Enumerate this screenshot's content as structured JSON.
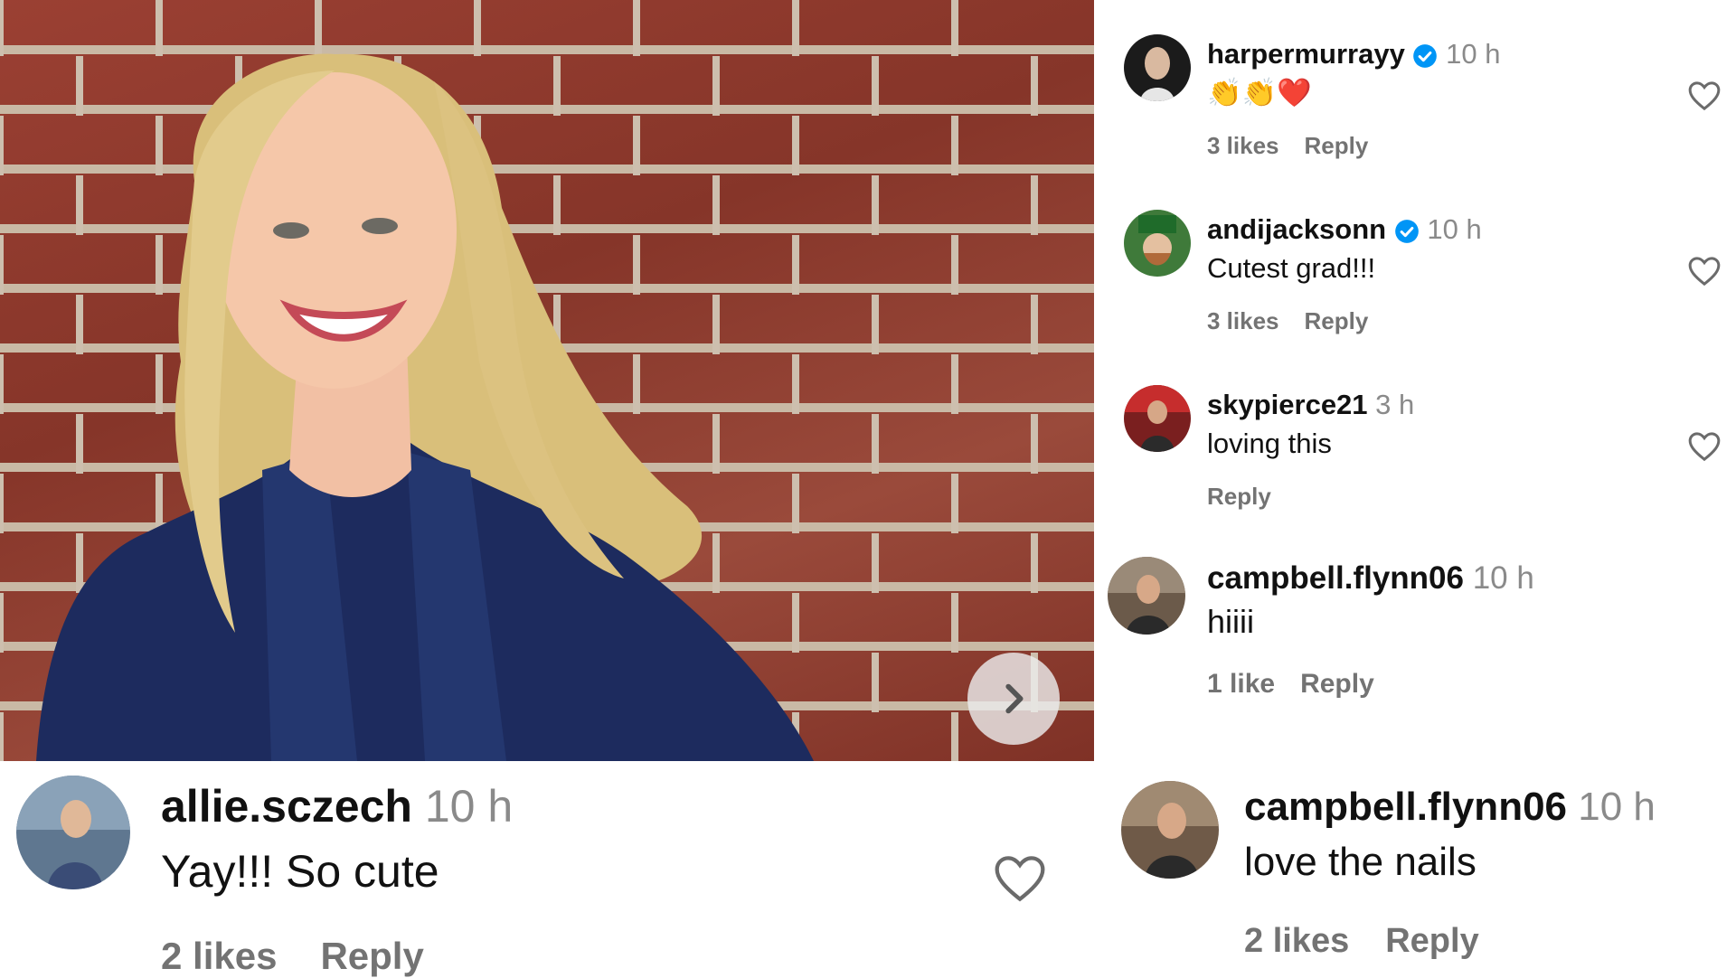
{
  "photo": {
    "next_icon": "chevron-right-icon"
  },
  "comments": [
    {
      "username": "harpermurrayy",
      "verified": true,
      "time": "10 h",
      "text": "👏👏❤️",
      "likes": "3 likes",
      "reply": "Reply"
    },
    {
      "username": "andijacksonn",
      "verified": true,
      "time": "10 h",
      "text": "Cutest grad!!!",
      "likes": "3 likes",
      "reply": "Reply"
    },
    {
      "username": "skypierce21",
      "verified": false,
      "time": "3 h",
      "text": "loving this",
      "reply": "Reply"
    },
    {
      "username": "campbell.flynn06",
      "verified": false,
      "time": "10 h",
      "text": "hiiii",
      "likes": "1 like",
      "reply": "Reply"
    },
    {
      "username": "allie.sczech",
      "verified": false,
      "time": "10 h",
      "text": "Yay!!! So cute",
      "likes": "2 likes",
      "reply": "Reply"
    },
    {
      "username": "campbell.flynn06",
      "verified": false,
      "time": "10 h",
      "text": "love the nails",
      "likes": "2 likes",
      "reply": "Reply"
    }
  ],
  "colors": {
    "verified_badge": "#0095f6",
    "muted_text": "#737373",
    "time_text": "#8a8a8a"
  }
}
